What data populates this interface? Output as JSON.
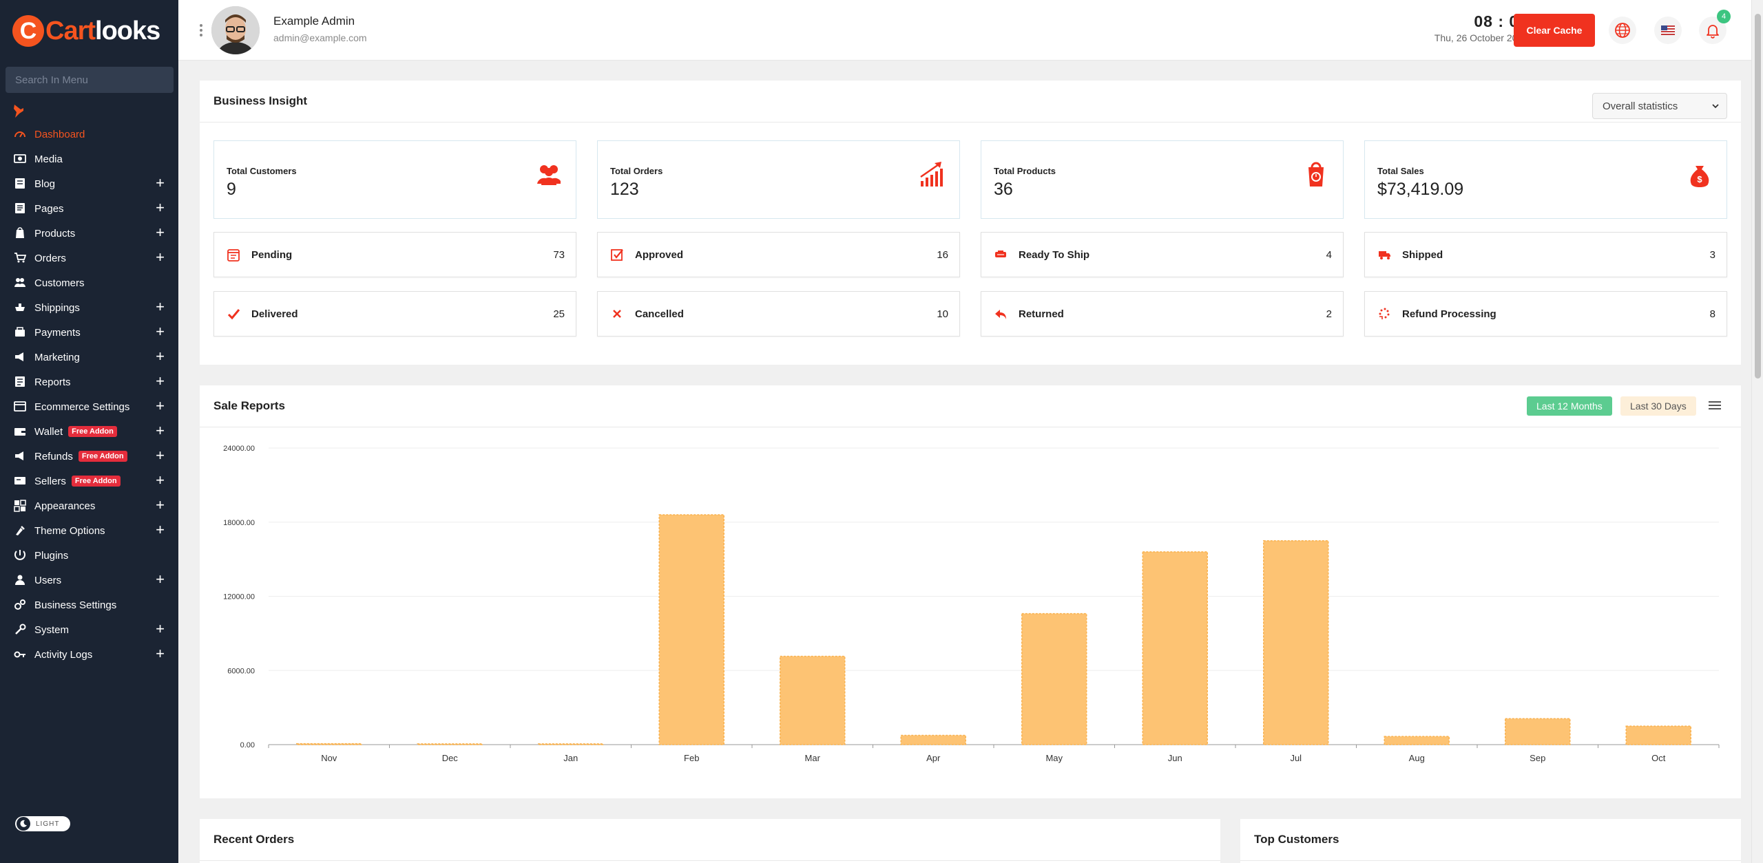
{
  "brand": {
    "logo_mark": "C",
    "logo_part1": "Cart",
    "logo_part2": "looks"
  },
  "sidebar": {
    "search_placeholder": "Search In Menu",
    "items": [
      {
        "label": "Dashboard",
        "icon": "dashboard-icon",
        "expandable": false,
        "active": true
      },
      {
        "label": "Media",
        "icon": "media-icon",
        "expandable": false
      },
      {
        "label": "Blog",
        "icon": "blog-icon",
        "expandable": true
      },
      {
        "label": "Pages",
        "icon": "pages-icon",
        "expandable": true
      },
      {
        "label": "Products",
        "icon": "products-icon",
        "expandable": true
      },
      {
        "label": "Orders",
        "icon": "orders-icon",
        "expandable": true
      },
      {
        "label": "Customers",
        "icon": "customers-icon",
        "expandable": false
      },
      {
        "label": "Shippings",
        "icon": "shippings-icon",
        "expandable": true
      },
      {
        "label": "Payments",
        "icon": "payments-icon",
        "expandable": true
      },
      {
        "label": "Marketing",
        "icon": "marketing-icon",
        "expandable": true
      },
      {
        "label": "Reports",
        "icon": "reports-icon",
        "expandable": true
      },
      {
        "label": "Ecommerce Settings",
        "icon": "ecommerce-settings-icon",
        "expandable": true
      },
      {
        "label": "Wallet",
        "icon": "wallet-icon",
        "expandable": true,
        "badge": "Free Addon"
      },
      {
        "label": "Refunds",
        "icon": "refunds-icon",
        "expandable": true,
        "badge": "Free Addon"
      },
      {
        "label": "Sellers",
        "icon": "sellers-icon",
        "expandable": true,
        "badge": "Free Addon"
      },
      {
        "label": "Appearances",
        "icon": "appearances-icon",
        "expandable": true
      },
      {
        "label": "Theme Options",
        "icon": "theme-options-icon",
        "expandable": true
      },
      {
        "label": "Plugins",
        "icon": "plugins-icon",
        "expandable": false
      },
      {
        "label": "Users",
        "icon": "users-icon",
        "expandable": true
      },
      {
        "label": "Business Settings",
        "icon": "business-settings-icon",
        "expandable": false
      },
      {
        "label": "System",
        "icon": "system-icon",
        "expandable": true
      },
      {
        "label": "Activity Logs",
        "icon": "activity-logs-icon",
        "expandable": true
      }
    ],
    "theme_toggle_label": "LIGHT"
  },
  "topbar": {
    "admin_name": "Example Admin",
    "admin_email": "admin@example.com",
    "time": "08 : 05",
    "date": "Thu, 26 October 2023",
    "clear_cache_label": "Clear Cache",
    "notification_count": "4"
  },
  "business_insight": {
    "title": "Business Insight",
    "filter_selected": "Overall statistics",
    "kpis": [
      {
        "label": "Total Customers",
        "value": "9",
        "icon": "customers-group-icon"
      },
      {
        "label": "Total Orders",
        "value": "123",
        "icon": "growth-chart-icon"
      },
      {
        "label": "Total Products",
        "value": "36",
        "icon": "shopping-bag-icon"
      },
      {
        "label": "Total Sales",
        "value": "$73,419.09",
        "icon": "money-bag-icon"
      }
    ],
    "order_statuses": [
      {
        "label": "Pending",
        "value": "73",
        "icon": "pending-icon"
      },
      {
        "label": "Approved",
        "value": "16",
        "icon": "approved-icon"
      },
      {
        "label": "Ready To Ship",
        "value": "4",
        "icon": "ready-to-ship-icon"
      },
      {
        "label": "Shipped",
        "value": "3",
        "icon": "shipped-icon"
      },
      {
        "label": "Delivered",
        "value": "25",
        "icon": "delivered-icon"
      },
      {
        "label": "Cancelled",
        "value": "10",
        "icon": "cancelled-icon"
      },
      {
        "label": "Returned",
        "value": "2",
        "icon": "returned-icon"
      },
      {
        "label": "Refund Processing",
        "value": "8",
        "icon": "refund-processing-icon"
      }
    ]
  },
  "sale_reports": {
    "title": "Sale Reports",
    "btn_12_months": "Last 12 Months",
    "btn_30_days": "Last 30 Days"
  },
  "recent_orders": {
    "title": "Recent Orders"
  },
  "top_customers": {
    "title": "Top Customers"
  },
  "colors": {
    "accent": "#f5541f",
    "sidebar_bg": "#1b2433",
    "bar": "#fdc373",
    "bar_border": "#f9b24f",
    "green": "#5ccc90"
  },
  "chart_data": {
    "type": "bar",
    "categories": [
      "Nov",
      "Dec",
      "Jan",
      "Feb",
      "Mar",
      "Apr",
      "May",
      "Jun",
      "Jul",
      "Aug",
      "Sep",
      "Oct"
    ],
    "values": [
      80,
      60,
      60,
      18600,
      7150,
      750,
      10600,
      15600,
      16500,
      660,
      2100,
      1500
    ],
    "y_ticks": [
      "0.00",
      "6000.00",
      "12000.00",
      "18000.00",
      "24000.00"
    ],
    "ylim": [
      0,
      24000
    ],
    "grid": true
  }
}
